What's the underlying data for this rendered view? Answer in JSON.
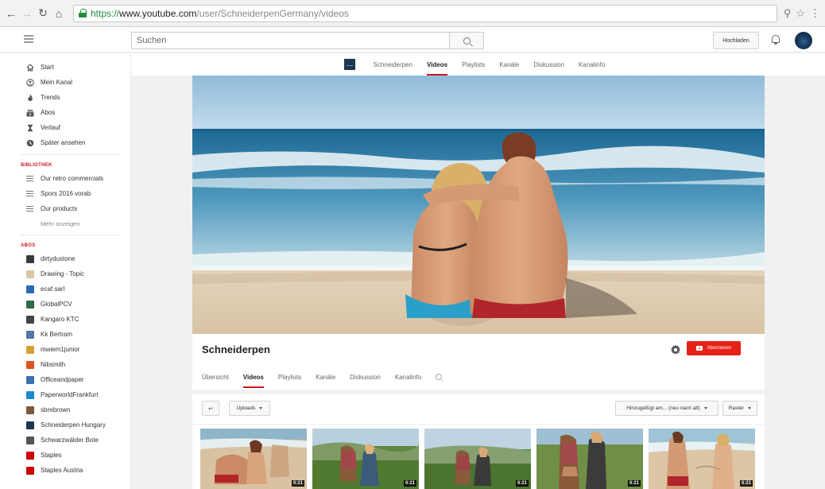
{
  "browser": {
    "url_scheme": "https://",
    "url_host": "www.youtube.com",
    "url_path": "/user/SchneiderpenGermany/videos"
  },
  "header": {
    "search_placeholder": "Suchen",
    "upload_label": "Hochladen"
  },
  "sidebar": {
    "main_items": [
      {
        "label": "Start",
        "icon": "home-icon"
      },
      {
        "label": "Mein Kanal",
        "icon": "person-icon"
      },
      {
        "label": "Trends",
        "icon": "flame-icon"
      },
      {
        "label": "Abos",
        "icon": "subscriptions-icon"
      },
      {
        "label": "Verlauf",
        "icon": "hourglass-icon"
      },
      {
        "label": "Später ansehen",
        "icon": "clock-icon"
      }
    ],
    "library_heading": "BIBLIOTHEK",
    "library_items": [
      {
        "label": "Our retro commercials"
      },
      {
        "label": "Spors 2016 vorab"
      },
      {
        "label": "Our products"
      }
    ],
    "more_label": "Mehr anzeigen",
    "abos_heading": "ABOS",
    "subscriptions": [
      {
        "label": "dirtydustone",
        "color": "#3a3a3a"
      },
      {
        "label": "Drawing - Topic",
        "color": "#d8c9a8"
      },
      {
        "label": "ecaf.sarl",
        "color": "#2a6ab3"
      },
      {
        "label": "GlobalPCV",
        "color": "#2f6b45"
      },
      {
        "label": "Kangaro KTC",
        "color": "#444444"
      },
      {
        "label": "Kk Bertram",
        "color": "#5577aa"
      },
      {
        "label": "mwiem1junior",
        "color": "#d9a030"
      },
      {
        "label": "Nibsmith",
        "color": "#e0541f"
      },
      {
        "label": "Officeandpaper",
        "color": "#3a6fb0"
      },
      {
        "label": "PaperworldFrankfurt",
        "color": "#1e88d0"
      },
      {
        "label": "sbrebrown",
        "color": "#7a5a3a"
      },
      {
        "label": "Schneiderpen Hungary",
        "color": "#1c3550"
      },
      {
        "label": "Schwarzwälder Bote",
        "color": "#555555"
      },
      {
        "label": "Staples",
        "color": "#cc0000"
      },
      {
        "label": "Staples Austria",
        "color": "#cc0000"
      }
    ]
  },
  "channel": {
    "name": "Schneiderpen",
    "top_tabs": [
      "Schneiderpen",
      "Videos",
      "Playlists",
      "Kanäle",
      "Diskussion",
      "Kanalinfo"
    ],
    "top_active": 1,
    "tabs": [
      "Übersicht",
      "Videos",
      "Playlists",
      "Kanäle",
      "Diskussion",
      "Kanalinfo"
    ],
    "active_tab": 1,
    "subscribe_label": "Abonnieren"
  },
  "videos": {
    "uploads_label": "Uploads",
    "sort_label": "Hinzugefügt am... (neu nach alt)",
    "view_label": "Raster",
    "durations": [
      "0:21",
      "0:21",
      "0:21",
      "0:21",
      "0:21"
    ]
  },
  "colors": {
    "accent": "#cc181e",
    "subscribe": "#e62117"
  }
}
